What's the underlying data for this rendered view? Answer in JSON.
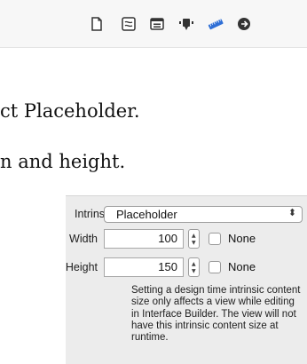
{
  "toolbar": {
    "icons": [
      {
        "name": "file-inspector-icon"
      },
      {
        "name": "quick-help-icon"
      },
      {
        "name": "identity-inspector-icon"
      },
      {
        "name": "attributes-inspector-icon"
      },
      {
        "name": "size-inspector-icon"
      },
      {
        "name": "connections-inspector-icon"
      }
    ],
    "accent": "#2f6fd6"
  },
  "document": {
    "line1": "ct Placeholder.",
    "line2": "n and height."
  },
  "inspector": {
    "intrinsic_size_label": "Intrinsic Size",
    "intrinsic_size_value": "Placeholder",
    "width_label": "Width",
    "width_value": "100",
    "width_none_label": "None",
    "width_none_checked": false,
    "height_label": "Height",
    "height_value": "150",
    "height_none_label": "None",
    "height_none_checked": false,
    "help_text": "Setting a design time intrinsic content size only affects a view while editing in Interface Builder. The view will not have this intrinsic content size at runtime."
  }
}
